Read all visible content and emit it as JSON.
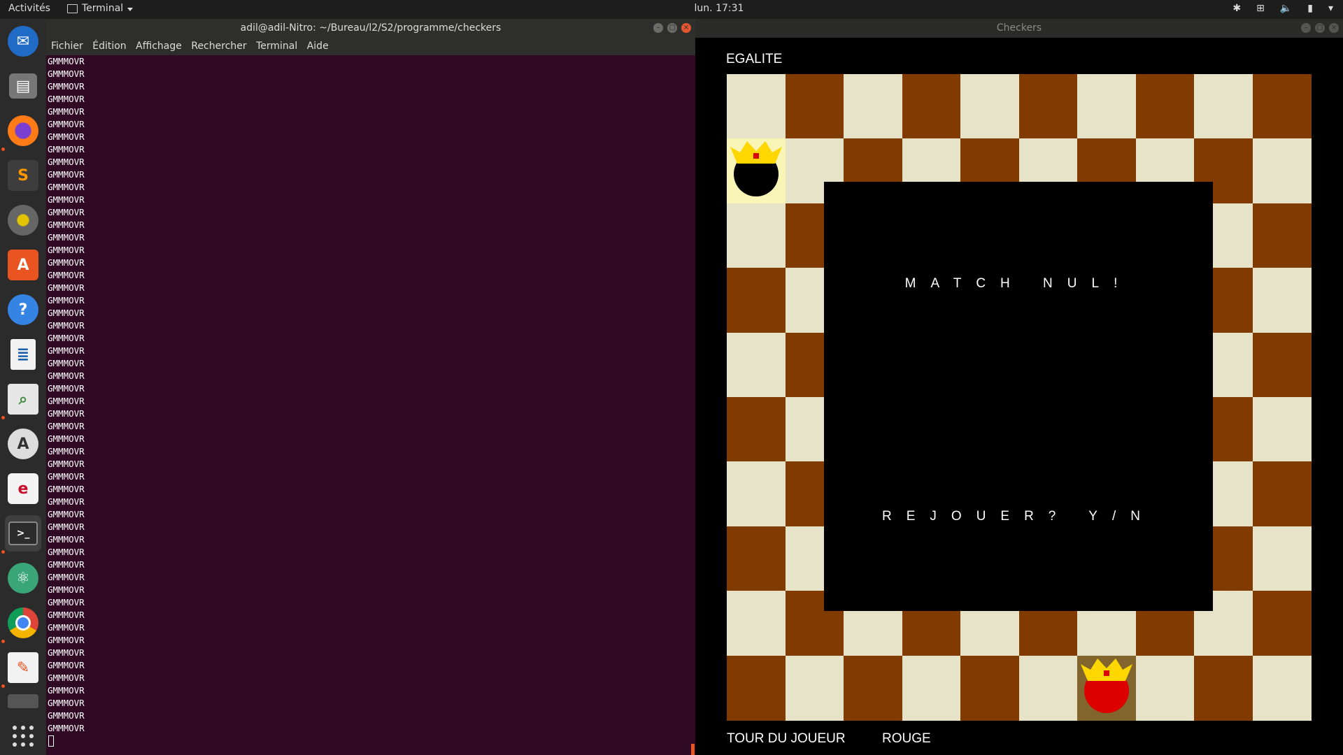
{
  "topbar": {
    "activities": "Activités",
    "app_menu": "Terminal",
    "clock": "lun. 17:31",
    "tray_icons": [
      "bluetooth-icon",
      "network-icon",
      "volume-icon",
      "battery-icon",
      "power-icon"
    ]
  },
  "dock": {
    "items": [
      "thunderbird-icon",
      "files-icon",
      "firefox-icon",
      "sublime-text-icon",
      "rhythmbox-icon",
      "software-center-icon",
      "help-icon",
      "writer-icon",
      "image-viewer-icon",
      "software-updater-icon",
      "text-editor-icon",
      "terminal-icon",
      "atom-icon",
      "chrome-icon",
      "notes-icon",
      "trash-icon",
      "show-applications-icon"
    ]
  },
  "terminal": {
    "title": "adil@adil-Nitro: ~/Bureau/l2/S2/programme/checkers",
    "menu": [
      "Fichier",
      "Édition",
      "Affichage",
      "Rechercher",
      "Terminal",
      "Aide"
    ],
    "line_text": "GMMMOVR",
    "line_count": 54,
    "colors": {
      "background": "#300a24",
      "text": "#ffffff"
    }
  },
  "checkers": {
    "window_title": "Checkers",
    "status_top": "EGALITE",
    "overlay_title": "MATCH NUL!",
    "overlay_prompt": "REJOUER? Y/N",
    "turn_label": "TOUR DU JOUEUR",
    "turn_player": "ROUGE",
    "colors": {
      "light": "#e6e3c8",
      "dark": "#813a00",
      "selected_black": "#f8f5b6",
      "selected_red": "#81652d",
      "red_piece": "#dd0000",
      "black_piece": "#000000",
      "crown": "#ffd700"
    },
    "pieces": [
      {
        "color": "black",
        "king": true,
        "row": 1,
        "col": 0
      },
      {
        "color": "red",
        "king": true,
        "row": 9,
        "col": 6
      }
    ]
  }
}
